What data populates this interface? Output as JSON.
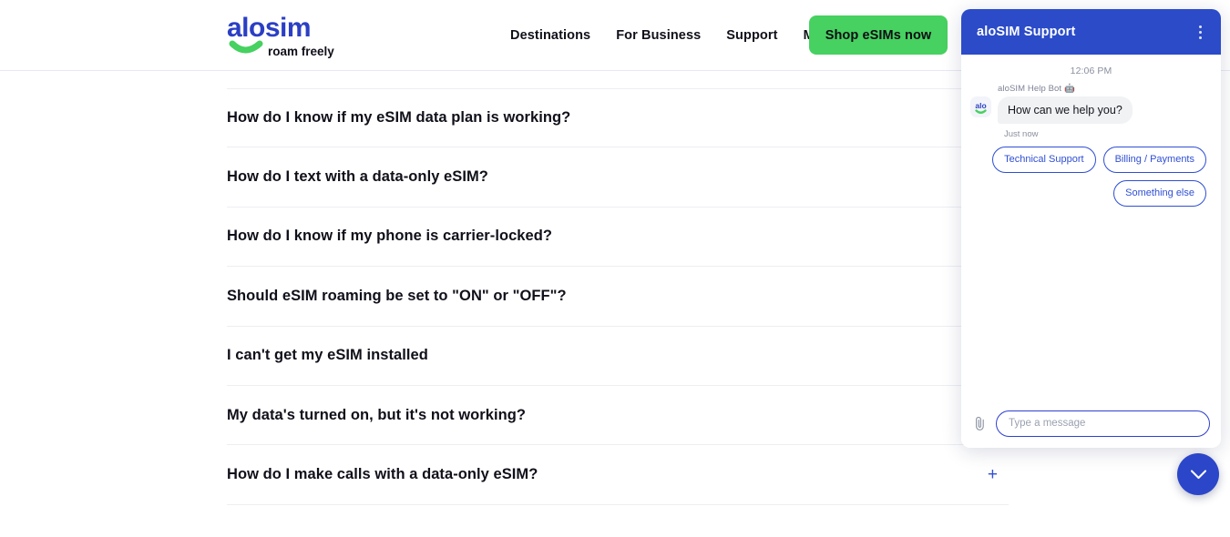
{
  "site": {
    "brand": {
      "name": "alosim",
      "tagline": "roam freely",
      "logo_color": "#2b3fc4",
      "smile_color": "#46d160"
    },
    "nav": [
      {
        "label": "Destinations",
        "name": "nav-destinations"
      },
      {
        "label": "For Business",
        "name": "nav-for-business"
      },
      {
        "label": "Support",
        "name": "nav-support"
      },
      {
        "label": "My eSIMs",
        "name": "nav-my-esims"
      }
    ],
    "cta": {
      "label": "Shop eSIMs now",
      "color": "#46d160"
    }
  },
  "faq": {
    "items": [
      {
        "question": "How do I know if my eSIM data plan is working?",
        "expand_icon": "+",
        "icon_visible": false
      },
      {
        "question": "How do I text with a data-only eSIM?",
        "expand_icon": "+",
        "icon_visible": false
      },
      {
        "question": "How do I know if my phone is carrier-locked?",
        "expand_icon": "+",
        "icon_visible": false
      },
      {
        "question": "Should eSIM roaming be set to \"ON\" or \"OFF\"?",
        "expand_icon": "+",
        "icon_visible": false
      },
      {
        "question": "I can't get my eSIM installed",
        "expand_icon": "+",
        "icon_visible": false
      },
      {
        "question": "My data's turned on, but it's not working?",
        "expand_icon": "+",
        "icon_visible": false
      },
      {
        "question": "How do I make calls with a data-only eSIM?",
        "expand_icon": "+",
        "icon_visible": true
      }
    ]
  },
  "chat": {
    "header": {
      "title": "aloSIM Support",
      "bg_color": "#2b4bc9",
      "menu_icon": "kebab-menu-icon"
    },
    "timestamp": "12:06 PM",
    "message": {
      "sender": "aloSIM Help Bot",
      "sender_emoji": "🤖",
      "text": "How can we help you?",
      "meta": "Just now",
      "avatar_icon": "alo-bot-avatar"
    },
    "quick_replies": [
      {
        "label": "Technical Support",
        "name": "quick-reply-technical-support"
      },
      {
        "label": "Billing / Payments",
        "name": "quick-reply-billing-payments"
      },
      {
        "label": "Something else",
        "name": "quick-reply-something-else"
      }
    ],
    "footer": {
      "attach_icon": "paperclip-icon",
      "input_placeholder": "Type a message",
      "input_value": ""
    },
    "toggle": {
      "icon": "chevron-down-icon",
      "color": "#2b46c8"
    }
  }
}
